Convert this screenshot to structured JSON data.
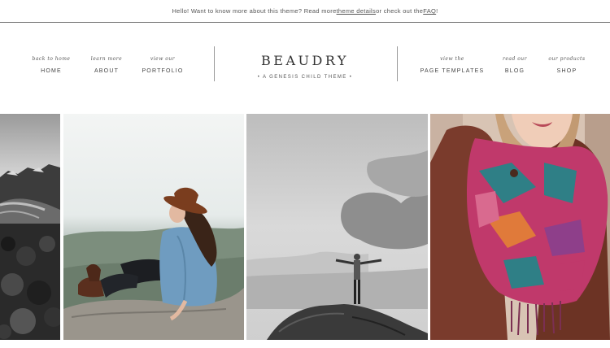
{
  "announcement": {
    "before": "Hello! Want to know more about this theme? Read more ",
    "link_details": "theme details",
    "middle": " or check out the ",
    "link_faq": "FAQ",
    "after": "!"
  },
  "nav_left": [
    {
      "tag": "back to home",
      "label": "HOME"
    },
    {
      "tag": "learn more",
      "label": "ABOUT"
    },
    {
      "tag": "view our",
      "label": "PORTFOLIO"
    }
  ],
  "brand": {
    "title": "BEAUDRY",
    "subtitle": "• A GENESIS CHILD THEME •"
  },
  "nav_right": [
    {
      "tag": "view the",
      "label": "PAGE TEMPLATES"
    },
    {
      "tag": "read our",
      "label": "BLOG"
    },
    {
      "tag": "our products",
      "label": "SHOP"
    }
  ],
  "gallery": [
    {
      "name": "mountain-landscape-photo",
      "subject": "rocky mountain glacier"
    },
    {
      "name": "woman-hat-photo",
      "subject": "woman in hat on rock"
    },
    {
      "name": "summit-man-photo",
      "subject": "man on summit"
    },
    {
      "name": "scarf-woman-photo",
      "subject": "woman in patterned scarf"
    }
  ],
  "colors": {
    "text": "#444444",
    "hat": "#7a3d1e",
    "denim": "#6f9cc0",
    "scarf_pink": "#c0396b",
    "scarf_teal": "#2f7f86"
  }
}
